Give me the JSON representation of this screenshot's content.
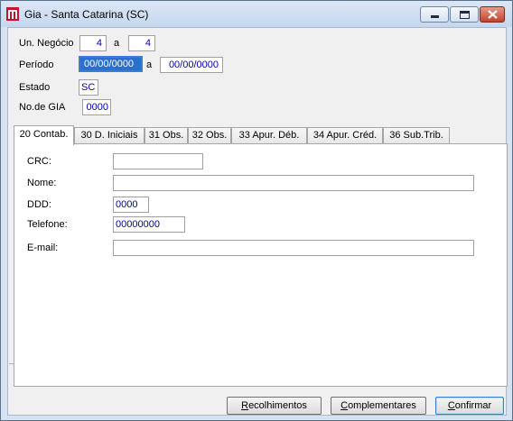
{
  "window": {
    "title": "Gia - Santa Catarina (SC)",
    "icon": "app-logo-icon",
    "controls": {
      "minimize": "minimize-icon",
      "maximize": "maximize-icon",
      "close": "close-icon"
    }
  },
  "header": {
    "un_negocio_label": "Un. Negócio",
    "un_negocio_from": "4",
    "un_negocio_sep": "a",
    "un_negocio_to": "4",
    "periodo_label": "Período",
    "periodo_from": "00/00/0000",
    "periodo_sep": "a",
    "periodo_to": "00/00/0000",
    "estado_label": "Estado",
    "estado_value": "SC",
    "nogia_label": "No.de GIA",
    "nogia_value": "0000"
  },
  "tabs": [
    {
      "label": "20 Contab."
    },
    {
      "label": "30 D. Iniciais"
    },
    {
      "label": "31 Obs."
    },
    {
      "label": "32 Obs."
    },
    {
      "label": "33 Apur. Déb."
    },
    {
      "label": "34 Apur. Créd."
    },
    {
      "label": "36  Sub.Trib."
    }
  ],
  "active_tab": "20 Contab.",
  "form": {
    "crc_label": "CRC:",
    "crc_value": "",
    "nome_label": "Nome:",
    "nome_value": "",
    "ddd_label": "DDD:",
    "ddd_value": "0000",
    "telefone_label": "Telefone:",
    "telefone_value": "00000000",
    "email_label": "E-mail:",
    "email_value": ""
  },
  "buttons": {
    "recolhimentos": "Recolhimentos",
    "complementares": "Complementares",
    "confirmar": "Confirmar"
  },
  "colors": {
    "field_text": "#0000a8",
    "focus_bg": "#2d6fcf",
    "window_frame": "#d6e2f0"
  }
}
